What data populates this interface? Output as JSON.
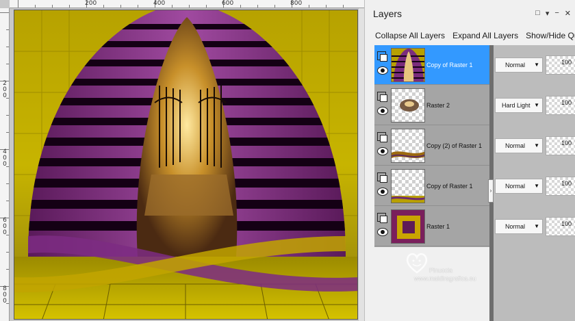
{
  "rulers": {
    "top_labels": [
      "200",
      "400",
      "600",
      "800"
    ],
    "left_labels": [
      "2\n0\n0",
      "4\n0\n0",
      "6\n0\n0",
      "8\n0\n0"
    ]
  },
  "panel": {
    "title": "Layers",
    "title_icons": [
      "pin-icon",
      "dropdown-icon",
      "minimize-icon",
      "close-icon"
    ],
    "toolbar": {
      "collapse_all": "Collapse All Layers",
      "expand_all": "Expand All Layers",
      "show_hide": "Show/Hide Quick"
    }
  },
  "layers": [
    {
      "name": "Copy of Raster 1",
      "blend": "Normal",
      "opacity": "100",
      "selected": true
    },
    {
      "name": "Raster 2",
      "blend": "Hard Light",
      "opacity": "100",
      "selected": false
    },
    {
      "name": "Copy (2) of Raster 1",
      "blend": "Normal",
      "opacity": "100",
      "selected": false
    },
    {
      "name": "Copy of Raster 1",
      "blend": "Normal",
      "opacity": "100",
      "selected": false
    },
    {
      "name": "Raster 1",
      "blend": "Normal",
      "opacity": "100",
      "selected": false
    }
  ],
  "watermark": {
    "name": "Pinuccia",
    "url": "www.maidiragrafica.eu"
  },
  "colors": {
    "selection": "#3399ff",
    "purple": "#6e1d70",
    "gold": "#c9b400"
  }
}
